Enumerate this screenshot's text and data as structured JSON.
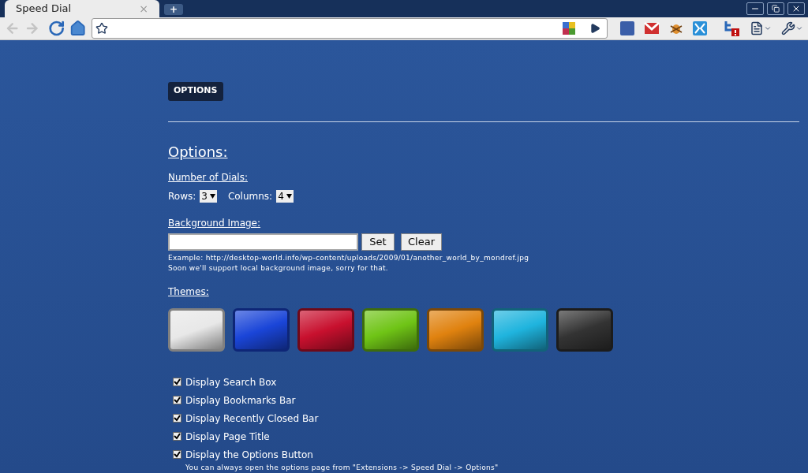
{
  "tab": {
    "title": "Speed Dial",
    "close": "×",
    "new_tab": "+"
  },
  "options_button": "OPTIONS",
  "heading": "Options:",
  "dials": {
    "label": "Number of Dials:",
    "rows_label": "Rows:",
    "rows_value": "3",
    "columns_label": "Columns:",
    "columns_value": "4"
  },
  "background": {
    "label": "Background Image:",
    "set": "Set",
    "clear": "Clear",
    "example": "Example: http://desktop-world.info/wp-content/uploads/2009/01/another_world_by_mondref.jpg",
    "note": "Soon we'll support local background image, sorry for that."
  },
  "themes": {
    "label": "Themes:",
    "items": [
      {
        "color": "#e8e8e8"
      },
      {
        "color": "#1a45d8"
      },
      {
        "color": "#c8102e"
      },
      {
        "color": "#6fc416"
      },
      {
        "color": "#e0820f"
      },
      {
        "color": "#1fb4de"
      },
      {
        "color": "#333333"
      }
    ]
  },
  "checkboxes": [
    {
      "label": "Display Search Box",
      "checked": true
    },
    {
      "label": "Display Bookmarks Bar",
      "checked": true
    },
    {
      "label": "Display Recently Closed Bar",
      "checked": true
    },
    {
      "label": "Display Page Title",
      "checked": true
    },
    {
      "label": "Display the Options Button",
      "checked": true
    }
  ],
  "options_hint": "You can always open the options page from \"Extensions -> Speed Dial -> Options\""
}
